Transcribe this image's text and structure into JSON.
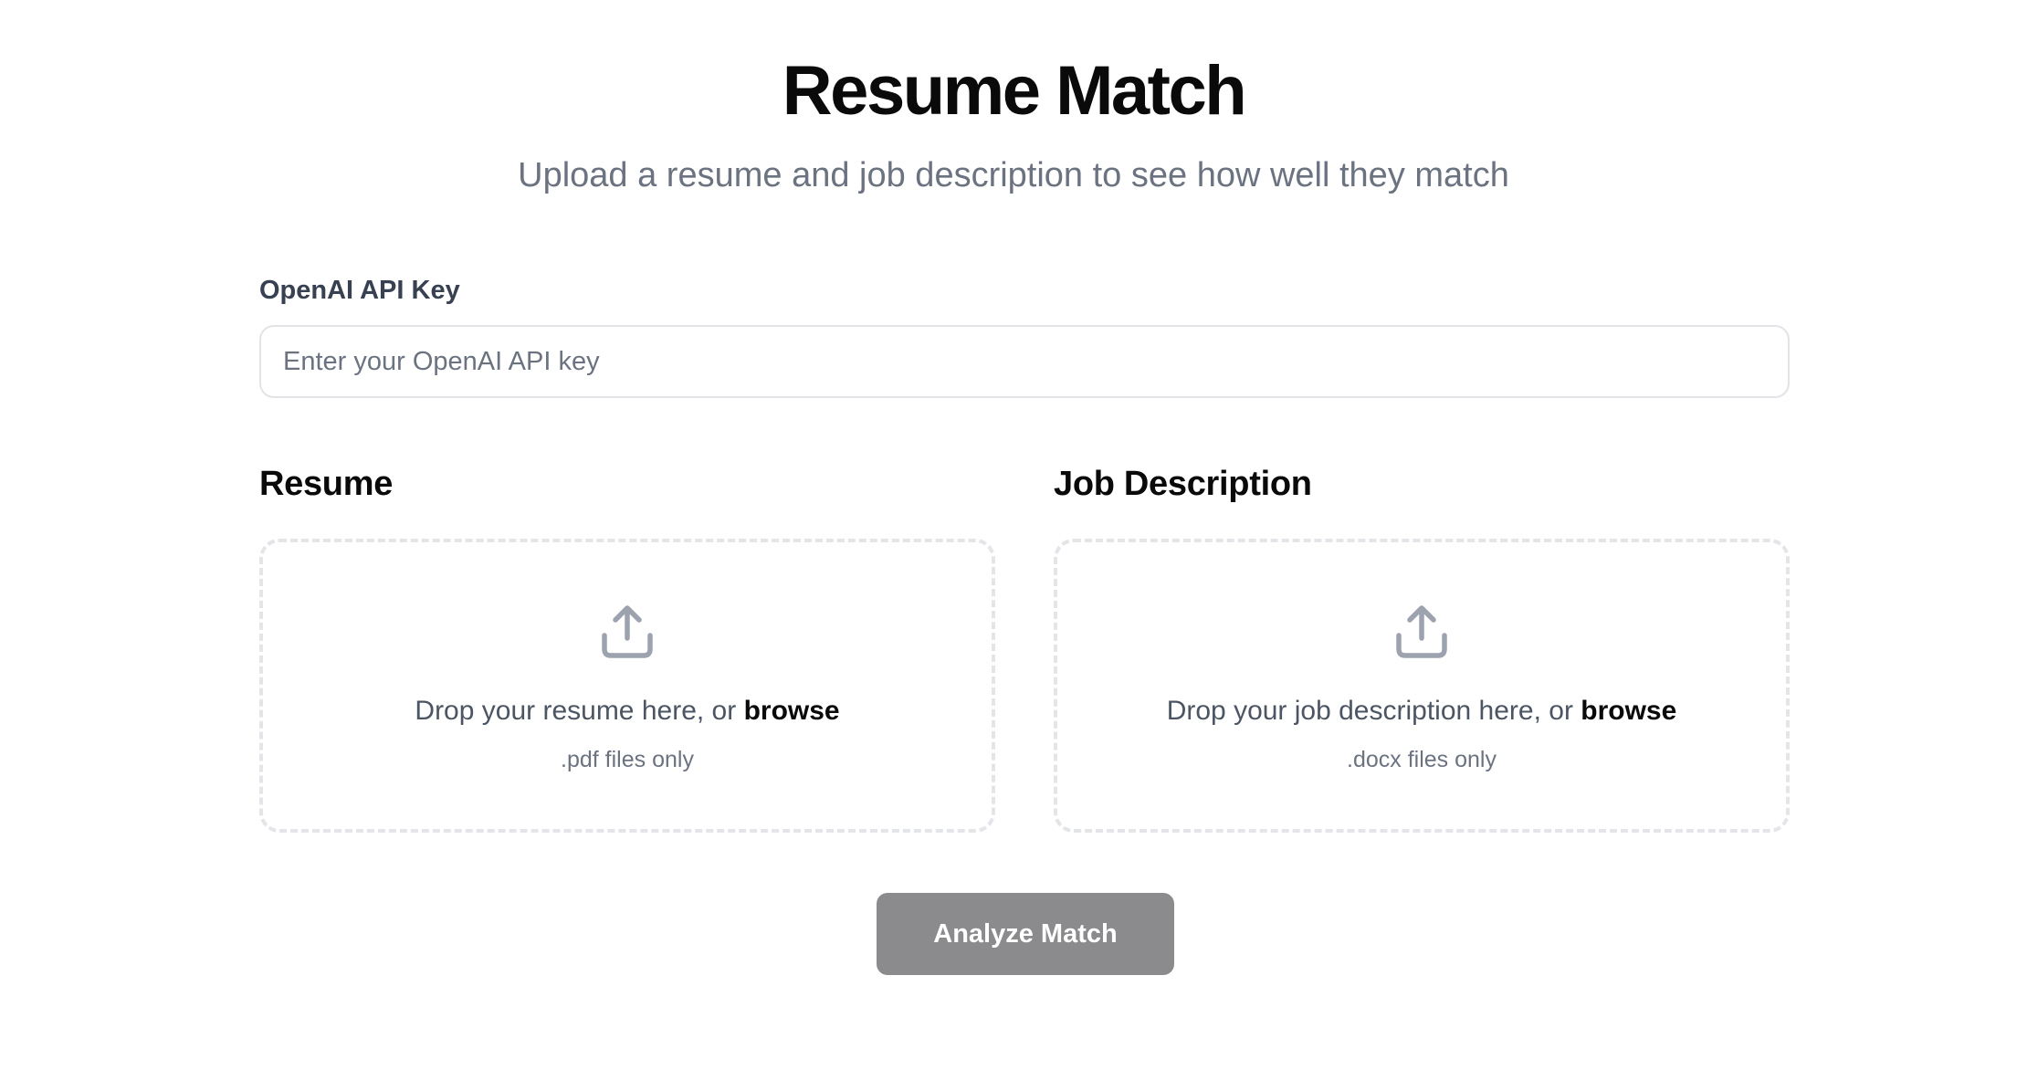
{
  "header": {
    "title": "Resume Match",
    "subtitle": "Upload a resume and job description to see how well they match"
  },
  "api_key": {
    "label": "OpenAI API Key",
    "placeholder": "Enter your OpenAI API key",
    "value": ""
  },
  "resume": {
    "heading": "Resume",
    "drop_text": "Drop your resume here, or ",
    "browse_label": "browse",
    "hint": ".pdf files only",
    "icon": "upload-icon"
  },
  "job_description": {
    "heading": "Job Description",
    "drop_text": "Drop your job description here, or ",
    "browse_label": "browse",
    "hint": ".docx files only",
    "icon": "upload-icon"
  },
  "actions": {
    "analyze_label": "Analyze Match"
  },
  "colors": {
    "title": "#0a0a0a",
    "muted_text": "#6b7280",
    "dropzone_border": "#e3e5e8",
    "icon": "#9ca3af",
    "button_bg": "#8b8b8d",
    "button_text": "#ffffff"
  }
}
